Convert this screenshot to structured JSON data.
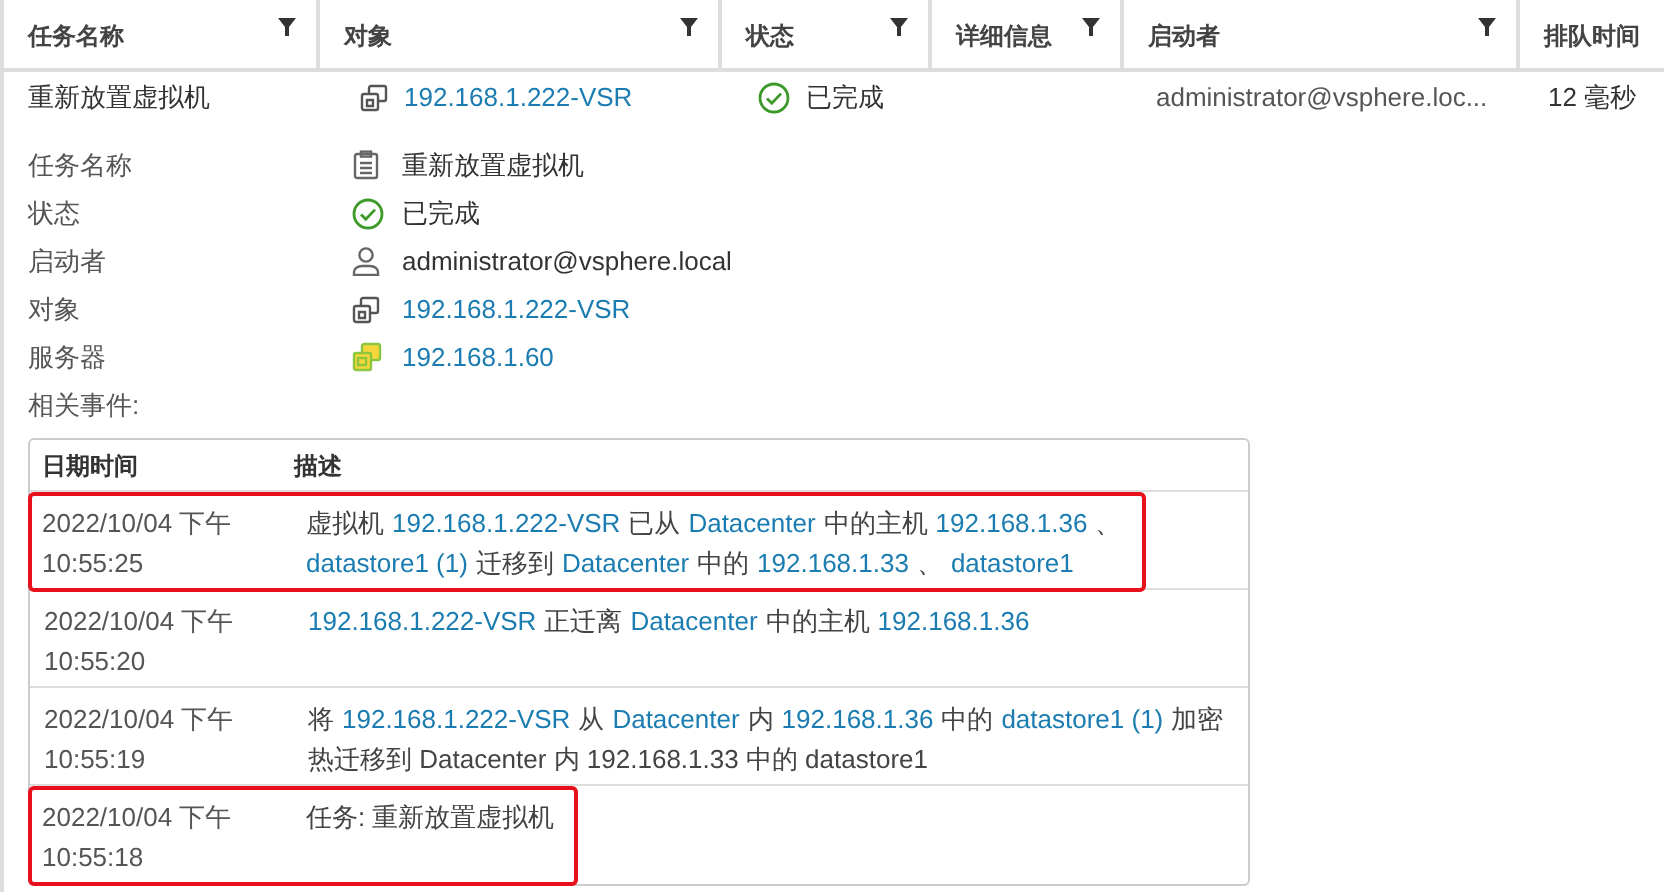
{
  "table": {
    "columns": [
      {
        "label": "任务名称",
        "filter": true
      },
      {
        "label": "对象",
        "filter": true
      },
      {
        "label": "状态",
        "filter": true
      },
      {
        "label": "详细信息",
        "filter": true
      },
      {
        "label": "启动者",
        "filter": true
      },
      {
        "label": "排队时间",
        "filter": false
      }
    ],
    "rows": [
      {
        "task": "重新放置虚拟机",
        "object": "192.168.1.222-VSR",
        "status": "已完成",
        "initiator": "administrator@vsphere.loc...",
        "queued": "12 毫秒"
      }
    ]
  },
  "details": [
    {
      "label": "任务名称",
      "value": "重新放置虚拟机",
      "kind": "task",
      "link": false
    },
    {
      "label": "状态",
      "value": "已完成",
      "kind": "status",
      "link": false
    },
    {
      "label": "启动者",
      "value": "administrator@vsphere.local",
      "kind": "user",
      "link": false
    },
    {
      "label": "对象",
      "value": "192.168.1.222-VSR",
      "kind": "vm",
      "link": true
    },
    {
      "label": "服务器",
      "value": "192.168.1.60",
      "kind": "server",
      "link": true
    }
  ],
  "events_label": "相关事件:",
  "events": {
    "columns": [
      "日期时间",
      "描述"
    ],
    "rows": [
      {
        "date": "2022/10/04 下午",
        "time": "10:55:25",
        "highlighted": true,
        "lines": [
          [
            {
              "text": "虚拟机",
              "link": false
            },
            {
              "text": "192.168.1.222-VSR",
              "link": true
            },
            {
              "text": "已从",
              "link": false
            },
            {
              "text": "Datacenter",
              "link": true
            },
            {
              "text": "中的主机",
              "link": false
            },
            {
              "text": "192.168.1.36",
              "link": true
            },
            {
              "text": "、",
              "link": false
            }
          ],
          [
            {
              "text": "datastore1 (1)",
              "link": true
            },
            {
              "text": "迁移到",
              "link": false
            },
            {
              "text": "Datacenter",
              "link": true
            },
            {
              "text": "中的",
              "link": false
            },
            {
              "text": "192.168.1.33",
              "link": true
            },
            {
              "text": "、",
              "link": false
            },
            {
              "text": "datastore1",
              "link": true
            }
          ]
        ]
      },
      {
        "date": "2022/10/04 下午",
        "time": "10:55:20",
        "highlighted": false,
        "lines": [
          [
            {
              "text": "192.168.1.222-VSR",
              "link": true
            },
            {
              "text": "正迁离",
              "link": false
            },
            {
              "text": "Datacenter",
              "link": true
            },
            {
              "text": "中的主机",
              "link": false
            },
            {
              "text": "192.168.1.36",
              "link": true
            }
          ]
        ]
      },
      {
        "date": "2022/10/04 下午",
        "time": "10:55:19",
        "highlighted": false,
        "lines": [
          [
            {
              "text": "将",
              "link": false
            },
            {
              "text": "192.168.1.222-VSR",
              "link": true
            },
            {
              "text": "从",
              "link": false
            },
            {
              "text": "Datacenter",
              "link": true
            },
            {
              "text": "内",
              "link": false
            },
            {
              "text": "192.168.1.36",
              "link": true
            },
            {
              "text": "中的",
              "link": false
            },
            {
              "text": "datastore1 (1)",
              "link": true
            },
            {
              "text": "加密",
              "link": false
            }
          ],
          [
            {
              "text": "热迁移到 Datacenter 内 192.168.1.33 中的 datastore1",
              "link": false
            }
          ]
        ]
      },
      {
        "date": "2022/10/04 下午",
        "time": "10:55:18",
        "highlighted": true,
        "lines": [
          [
            {
              "text": "任务: 重新放置虚拟机",
              "link": false
            }
          ]
        ]
      }
    ]
  }
}
